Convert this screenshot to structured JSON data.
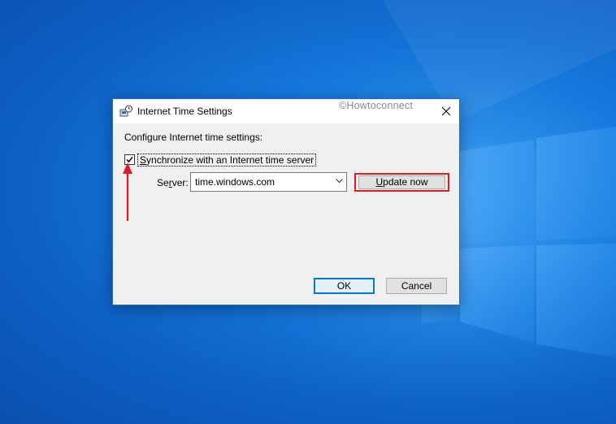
{
  "dialog": {
    "title": "Internet Time Settings",
    "watermark": "©Howtoconnect",
    "heading": "Configure Internet time settings:",
    "sync_checkbox": {
      "label_first": "S",
      "label_rest": "ynchronize with an Internet time server",
      "checked": true
    },
    "server": {
      "label_first": "Se",
      "label_underlined": "r",
      "label_rest": "ver:",
      "value": "time.windows.com"
    },
    "update_button": {
      "label_first": "U",
      "label_rest": "pdate now"
    },
    "ok_label": "OK",
    "cancel_label": "Cancel"
  },
  "colors": {
    "desktop_blue": "#1779dc",
    "highlight_red": "#e01b24",
    "dialog_border": "#1d6fc4",
    "ok_border": "#0078d7"
  },
  "icons": {
    "title": "clock-network-icon",
    "close": "close-icon",
    "dropdown": "chevron-down-icon",
    "annotation": "red-arrow-icon"
  }
}
